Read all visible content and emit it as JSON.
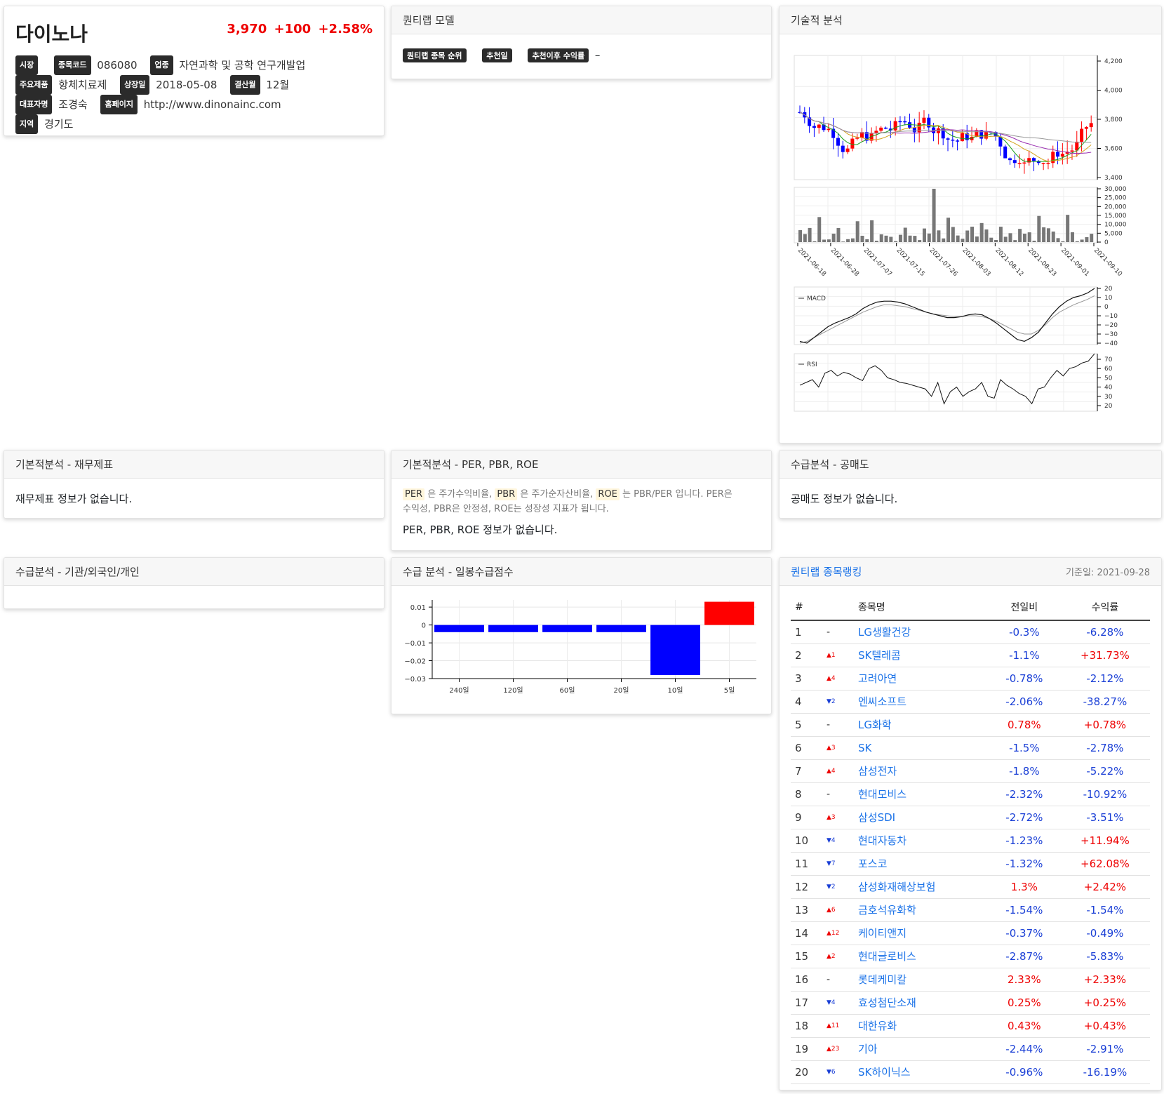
{
  "stock": {
    "name": "다이노나",
    "price": "3,970",
    "change": "+100",
    "change_pct": "+2.58%",
    "info": {
      "market_label": "시장",
      "code_label": "종목코드",
      "code": "086080",
      "industry_label": "업종",
      "industry": "자연과학 및 공학 연구개발업",
      "product_label": "주요제품",
      "product": "항체치료제",
      "listed_label": "상장일",
      "listed": "2018-05-08",
      "fiscal_label": "결산월",
      "fiscal": "12월",
      "ceo_label": "대표자명",
      "ceo": "조경숙",
      "homepage_label": "홈페이지",
      "homepage": "http://www.dinonainc.com",
      "region_label": "지역",
      "region": "경기도"
    }
  },
  "quant_model": {
    "title": "퀀티랩 모델",
    "rank_label": "퀀티랩 종목 순위",
    "date_label": "추천일",
    "return_label": "추천이후 수익률",
    "return_value": "–"
  },
  "technical": {
    "title": "기술적 분석",
    "macd_label": "MACD",
    "rsi_label": "RSI",
    "price_ticks": [
      "4,200",
      "4,000",
      "3,800",
      "3,600",
      "3,400"
    ],
    "volume_ticks": [
      "30,000",
      "25,000",
      "20,000",
      "15,000",
      "10,000",
      "5,000",
      "0"
    ],
    "date_ticks": [
      "2021-06-18",
      "2021-06-28",
      "2021-07-07",
      "2021-07-15",
      "2021-07-26",
      "2021-08-03",
      "2021-08-12",
      "2021-08-23",
      "2021-09-01",
      "2021-09-10"
    ],
    "macd_ticks": [
      "20",
      "10",
      "0",
      "−10",
      "−20",
      "−30",
      "−40"
    ],
    "rsi_ticks": [
      "70",
      "60",
      "50",
      "40",
      "30",
      "20"
    ]
  },
  "financial": {
    "title": "기본적분석 - 재무제표",
    "message": "재무제표 정보가 없습니다."
  },
  "per": {
    "title": "기본적분석 - PER, PBR, ROE",
    "per_tag": "PER",
    "per_desc": "은 주가수익비율,",
    "pbr_tag": "PBR",
    "pbr_desc": "은 주가순자산비율,",
    "roe_tag": "ROE",
    "roe_desc": "는 PBR/PER 입니다. PER은",
    "desc2": "수익성, PBR은 안정성, ROE는 성장성 지표가 됩니다.",
    "message": "PER, PBR, ROE 정보가 없습니다."
  },
  "short": {
    "title": "수급분석 - 공매도",
    "message": "공매도 정보가 없습니다."
  },
  "investor": {
    "title": "수급분석 - 기관/외국인/개인"
  },
  "supply": {
    "title": "수급 분석 - 일봉수급점수",
    "y_ticks": [
      "0.01",
      "0",
      "−0.01",
      "−0.02",
      "−0.03"
    ]
  },
  "chart_data": {
    "type": "bar",
    "categories": [
      "240일",
      "120일",
      "60일",
      "20일",
      "10일",
      "5일"
    ],
    "values": [
      -0.004,
      -0.004,
      -0.004,
      -0.004,
      -0.028,
      0.013
    ],
    "ylim": [
      -0.03,
      0.014
    ],
    "colors": {
      "negative": "#0000ff",
      "positive": "#ff0000"
    }
  },
  "ranking": {
    "title": "퀀티랩 종목랭킹",
    "base_date": "기준일: 2021-09-28",
    "headers": {
      "num": "#",
      "name": "종목명",
      "day": "전일비",
      "ret": "수익률"
    },
    "rows": [
      {
        "num": "1",
        "chg": "-",
        "dir": "none",
        "name": "LG생활건강",
        "day": "-0.3%",
        "ret": "-6.28%"
      },
      {
        "num": "2",
        "chg": "▲1",
        "dir": "up",
        "name": "SK텔레콤",
        "day": "-1.1%",
        "ret": "+31.73%"
      },
      {
        "num": "3",
        "chg": "▲4",
        "dir": "up",
        "name": "고려아연",
        "day": "-0.78%",
        "ret": "-2.12%"
      },
      {
        "num": "4",
        "chg": "▼2",
        "dir": "down",
        "name": "엔씨소프트",
        "day": "-2.06%",
        "ret": "-38.27%"
      },
      {
        "num": "5",
        "chg": "-",
        "dir": "none",
        "name": "LG화학",
        "day": "0.78%",
        "ret": "+0.78%"
      },
      {
        "num": "6",
        "chg": "▲3",
        "dir": "up",
        "name": "SK",
        "day": "-1.5%",
        "ret": "-2.78%"
      },
      {
        "num": "7",
        "chg": "▲4",
        "dir": "up",
        "name": "삼성전자",
        "day": "-1.8%",
        "ret": "-5.22%"
      },
      {
        "num": "8",
        "chg": "-",
        "dir": "none",
        "name": "현대모비스",
        "day": "-2.32%",
        "ret": "-10.92%"
      },
      {
        "num": "9",
        "chg": "▲3",
        "dir": "up",
        "name": "삼성SDI",
        "day": "-2.72%",
        "ret": "-3.51%"
      },
      {
        "num": "10",
        "chg": "▼4",
        "dir": "down",
        "name": "현대자동차",
        "day": "-1.23%",
        "ret": "+11.94%"
      },
      {
        "num": "11",
        "chg": "▼7",
        "dir": "down",
        "name": "포스코",
        "day": "-1.32%",
        "ret": "+62.08%"
      },
      {
        "num": "12",
        "chg": "▼2",
        "dir": "down",
        "name": "삼성화재해상보험",
        "day": "1.3%",
        "ret": "+2.42%"
      },
      {
        "num": "13",
        "chg": "▲6",
        "dir": "up",
        "name": "금호석유화학",
        "day": "-1.54%",
        "ret": "-1.54%"
      },
      {
        "num": "14",
        "chg": "▲12",
        "dir": "up",
        "name": "케이티앤지",
        "day": "-0.37%",
        "ret": "-0.49%"
      },
      {
        "num": "15",
        "chg": "▲2",
        "dir": "up",
        "name": "현대글로비스",
        "day": "-2.87%",
        "ret": "-5.83%"
      },
      {
        "num": "16",
        "chg": "-",
        "dir": "none",
        "name": "롯데케미칼",
        "day": "2.33%",
        "ret": "+2.33%"
      },
      {
        "num": "17",
        "chg": "▼4",
        "dir": "down",
        "name": "효성첨단소재",
        "day": "0.25%",
        "ret": "+0.25%"
      },
      {
        "num": "18",
        "chg": "▲11",
        "dir": "up",
        "name": "대한유화",
        "day": "0.43%",
        "ret": "+0.43%"
      },
      {
        "num": "19",
        "chg": "▲23",
        "dir": "up",
        "name": "기아",
        "day": "-2.44%",
        "ret": "-2.91%"
      },
      {
        "num": "20",
        "chg": "▼6",
        "dir": "down",
        "name": "SK하이닉스",
        "day": "-0.96%",
        "ret": "-16.19%"
      }
    ]
  }
}
